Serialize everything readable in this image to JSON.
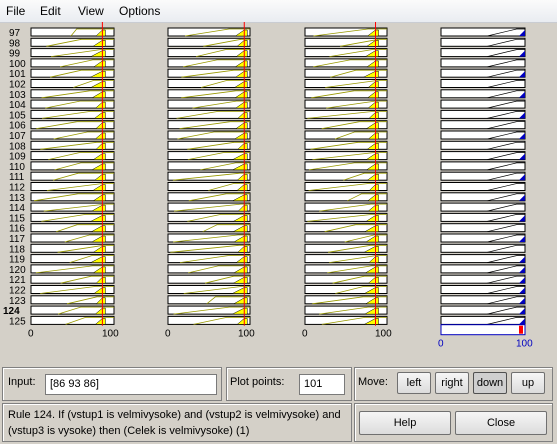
{
  "menu": {
    "file": "File",
    "edit": "Edit",
    "view": "View",
    "options": "Options"
  },
  "rows": [
    "97",
    "98",
    "99",
    "100",
    "101",
    "102",
    "103",
    "104",
    "105",
    "106",
    "107",
    "108",
    "109",
    "110",
    "111",
    "112",
    "113",
    "114",
    "115",
    "116",
    "117",
    "118",
    "119",
    "120",
    "121",
    "122",
    "123",
    "124",
    "125"
  ],
  "highlight_row": {
    "label": "124",
    "color": "#ff0000"
  },
  "axes": {
    "input_min": "0",
    "input_max": "100",
    "output_min": "0",
    "output_max": "100",
    "input_ticks": [
      "0",
      "100",
      "0",
      "100",
      "0",
      "100"
    ]
  },
  "colors": {
    "input_fill": "#ffff00",
    "output_fill": "#0000c0",
    "cursor_line": "#ff0000",
    "highlight_fill": "#ff0000"
  },
  "input_values": [
    86,
    93,
    86
  ],
  "input": {
    "label": "Input:",
    "value": "[86 93 86]"
  },
  "plot": {
    "label": "Plot points:",
    "value": "101"
  },
  "move": {
    "label": "Move:",
    "left": "left",
    "right": "right",
    "down": "down",
    "up": "up"
  },
  "rule_text": "Rule 124. If (vstup1 is velmivysoke) and (vstup2 is velmivysoke) and (vstup3 is vysoke) then (Celek is velmivysoke) (1)",
  "help": "Help",
  "close": "Close"
}
